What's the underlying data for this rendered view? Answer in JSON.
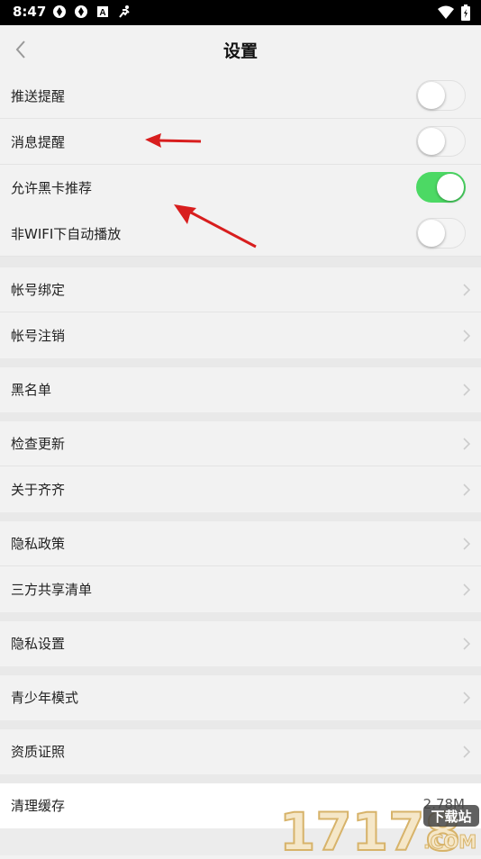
{
  "status_bar": {
    "time": "8:47"
  },
  "nav": {
    "title": "设置"
  },
  "toggles": [
    {
      "label": "推送提醒",
      "on": false
    },
    {
      "label": "消息提醒",
      "on": false
    },
    {
      "label": "允许黑卡推荐",
      "on": true
    },
    {
      "label": "非WIFI下自动播放",
      "on": false
    }
  ],
  "menu": {
    "account_binding": "帐号绑定",
    "account_cancel": "帐号注销",
    "blacklist": "黑名单",
    "check_update": "检查更新",
    "about": "关于齐齐",
    "privacy_policy": "隐私政策",
    "third_party": "三方共享清单",
    "privacy_settings": "隐私设置",
    "youth_mode": "青少年模式",
    "qualification": "资质证照",
    "clear_cache": "清理缓存",
    "cache_size": "2.78M"
  },
  "watermark": {
    "number": "17178",
    "site": "下载站",
    "domain": ".COM"
  },
  "colors": {
    "switch_on": "#4cd964",
    "arrow": "#d81e1e"
  }
}
